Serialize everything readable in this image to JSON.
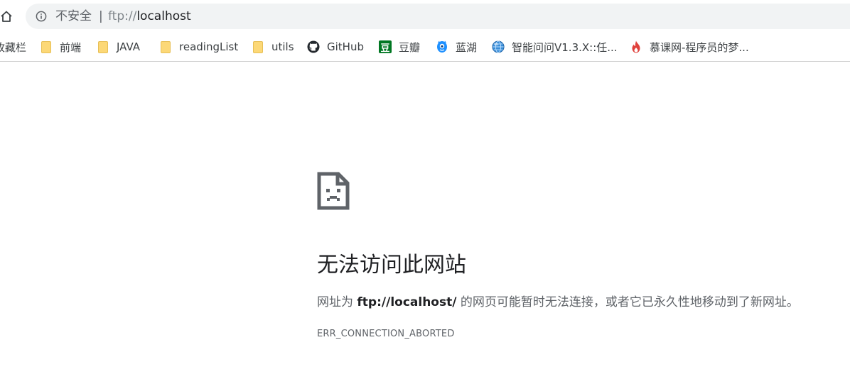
{
  "address_bar": {
    "security_label": "不安全",
    "separator": "|",
    "url_scheme": "ftp://",
    "url_host": "localhost"
  },
  "bookmarks": [
    {
      "label": "收藏栏",
      "icon": "none"
    },
    {
      "label": "前端",
      "icon": "folder-icon"
    },
    {
      "label": "JAVA",
      "icon": "folder-icon"
    },
    {
      "label": "readingList",
      "icon": "folder-icon"
    },
    {
      "label": "utils",
      "icon": "folder-icon"
    },
    {
      "label": "GitHub",
      "icon": "github-icon"
    },
    {
      "label": "豆瓣",
      "icon": "douban-icon"
    },
    {
      "label": "蓝湖",
      "icon": "lanhu-icon"
    },
    {
      "label": "智能问问V1.3.X::任...",
      "icon": "globe-icon"
    },
    {
      "label": "慕课网-程序员的梦...",
      "icon": "flame-icon"
    }
  ],
  "error": {
    "title": "无法访问此网站",
    "message_prefix": "网址为 ",
    "message_url": "ftp://localhost/",
    "message_suffix": " 的网页可能暂时无法连接，或者它已永久性地移动到了新网址。",
    "code": "ERR_CONNECTION_ABORTED"
  },
  "colors": {
    "omnibox_bg": "#f1f3f4",
    "folder": "#fcd877",
    "douban": "#007722",
    "lanhu": "#1e90ff",
    "flame": "#e0413c",
    "sad_page": "#5f6368"
  }
}
